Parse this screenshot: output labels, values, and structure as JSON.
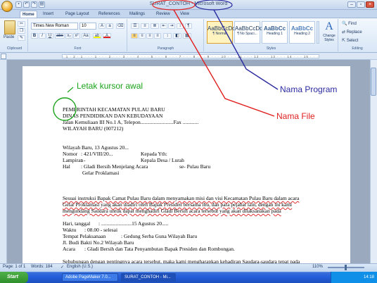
{
  "title_bar": {
    "doc_name": "SURAT_CONTOH",
    "separator": " - ",
    "app_name": "Microsoft Word"
  },
  "tabs": [
    "Home",
    "Insert",
    "Page Layout",
    "References",
    "Mailings",
    "Review",
    "View"
  ],
  "ribbon": {
    "clipboard": {
      "paste": "Paste",
      "label": "Clipboard"
    },
    "font": {
      "family": "Times New Roman",
      "size": "10",
      "label": "Font",
      "btns": [
        "B",
        "I",
        "U",
        "abe",
        "x₂",
        "x²",
        "Aa"
      ]
    },
    "paragraph": {
      "label": "Paragraph"
    },
    "styles": {
      "label": "Styles",
      "items": [
        {
          "preview": "AaBbCcDc",
          "name": "¶ Normal"
        },
        {
          "preview": "AaBbCcDc",
          "name": "¶ No Spaci..."
        },
        {
          "preview": "AaBbCc",
          "name": "Heading 1"
        },
        {
          "preview": "AaBbCc",
          "name": "Heading 2"
        }
      ],
      "change": "Change Styles"
    },
    "editing": {
      "label": "Editing",
      "find": "Find",
      "replace": "Replace",
      "select": "Select"
    }
  },
  "ruler_text": "· 1 · 2 · 1 · · · 1 · · · 2 · · · 3 · · · 4 · · · 5 · · · 6 · · · 7 · · · 8 · · · 9 · · · 10 · · · 11 · · · 12 · · · 13 · · · 14 · · · 15 · · · 16 ·",
  "annotations": {
    "cursor": "Letak kursor awal",
    "program": "Nama Program",
    "file": "Nama File"
  },
  "document": {
    "header": [
      "PEMERINTAH KECAMATAN PULAU BARU",
      "DINAS PENDIDIKAN DAN KEBUDAYAAN",
      "Jalan Kemuliaan III No.1 A, Telepon.........................Fax ............",
      "WILAYAH BARU (007212)"
    ],
    "place_date": "Wilayah Baru, 13 Agustus 20...",
    "meta": [
      {
        "k": "Nomor",
        "v": ":          421/VIII/20...",
        "k2": "Kepada Yth:"
      },
      {
        "k": "Lampiran",
        "v": ":          -",
        "k2": "Kepala Desa / Lurah"
      },
      {
        "k": "Hal",
        "v": ":          Gladi Bersih Menjelang Acara",
        "k2": "se-  Pulau Baru"
      }
    ],
    "subject2": "Gelar Proklamasi",
    "body": [
      "Sesuai instruksi Bapak Camat Pulau Baru dalam menyamakan misi dan visi Kecamatan Pulau Baru dalam acara",
      "Gelar Proklamasi yang akan diadiri oleh Bapak Presiden bersama ibu, dan para pejabat lain, dengan ini kami",
      "mengundang Saudara untuk dapat menghadiri Gladi Bersih acara tersebut yang akan dilaksanakan pada"
    ],
    "event": [
      {
        "k": "Hari, tanggal",
        "v": ":  .......................15 Agustus 20....."
      },
      {
        "k": "Waktu",
        "v": ":          08.00 - selesai"
      },
      {
        "k": "Tempat Pelaksanaan",
        "v": ":          Gedung Serba Guna Wilayah Baru"
      },
      {
        "k": "Jl. Budi Bakti No.2 Wilayah Baru",
        "v": ""
      },
      {
        "k": "Acara",
        "v": ":          Gladi Bersih dan Tata Penyambutan Bapak Presiden dan Rombongan."
      }
    ],
    "closing": "Sehubungan dengan pentingnya acara tersebut, maka kami mengharapkan kehadiran Saudara-saudara tepat pada"
  },
  "status": {
    "page": "Page: 1 of 1",
    "words": "Words: 184",
    "lang": "English (U.S.)",
    "zoom": "110%"
  },
  "taskbar": {
    "start": "Start",
    "tasks": [
      "Adobe PageMaker 7.0...",
      "SURAT_CONTOH - Mi..."
    ],
    "clock": "14:18"
  },
  "colors": {
    "annotation_green": "#1aa31a",
    "annotation_red": "#e02020",
    "annotation_blue": "#2a2aa0"
  }
}
